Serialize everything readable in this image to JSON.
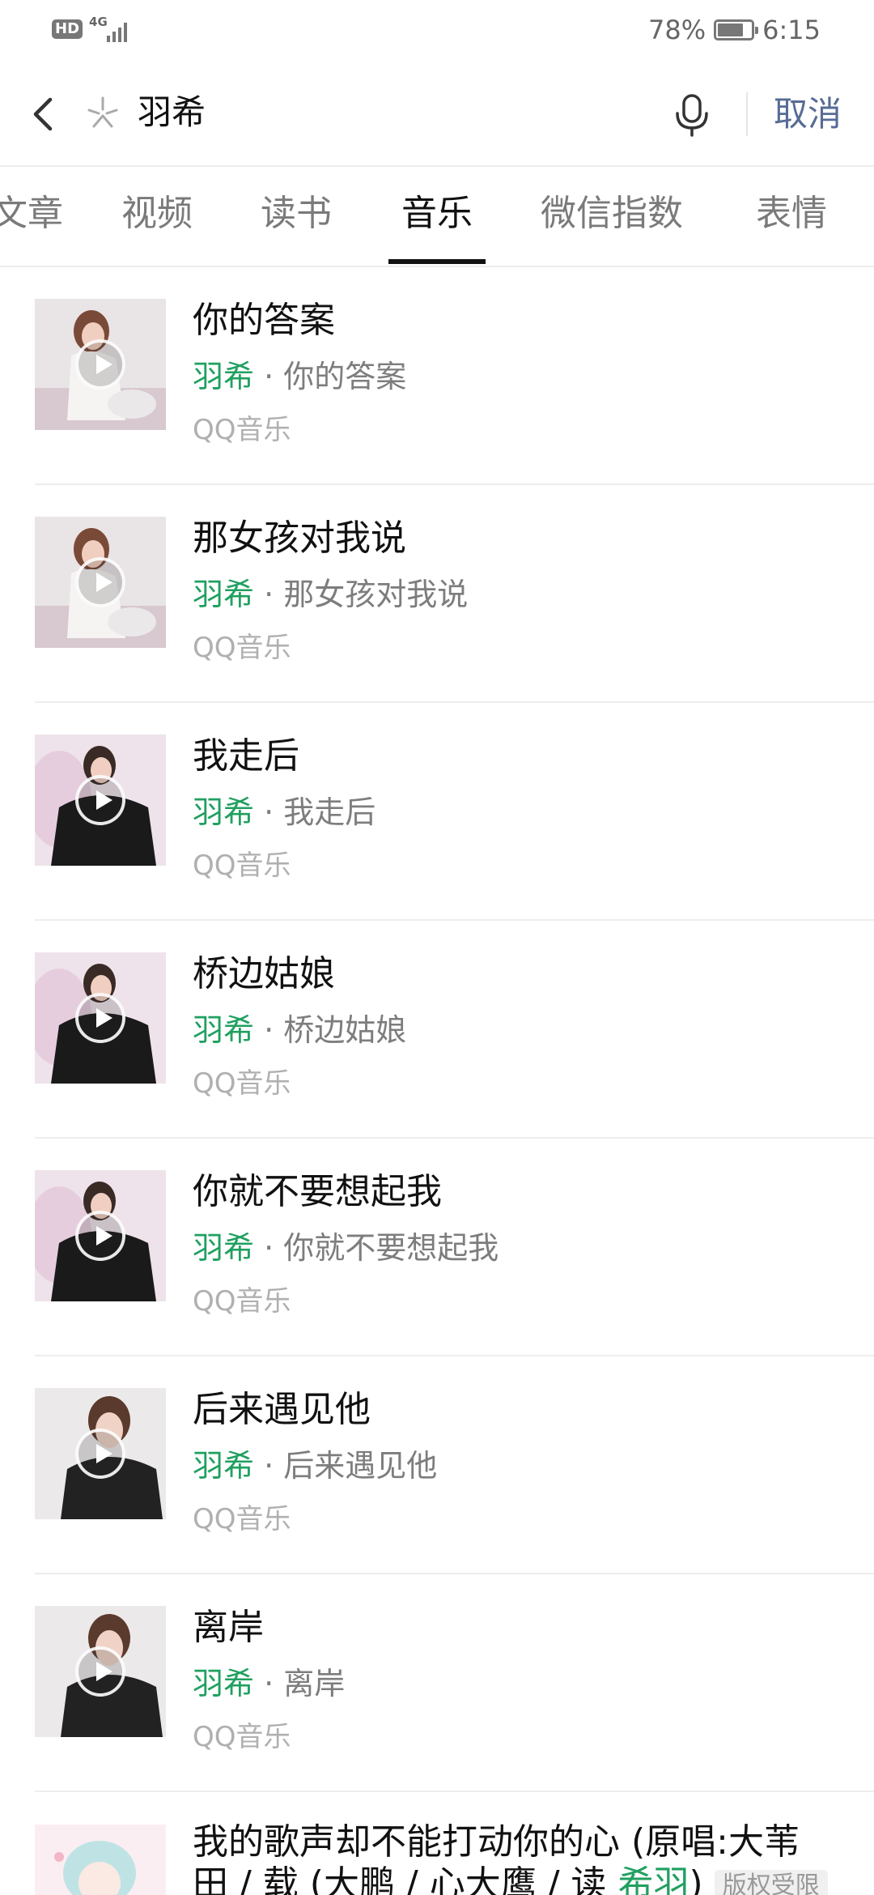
{
  "status_bar": {
    "hd": "HD",
    "network": "4G",
    "battery": "78%",
    "time": "6:15"
  },
  "search": {
    "query": "羽希",
    "cancel_label": "取消"
  },
  "tabs": [
    {
      "label": "文章"
    },
    {
      "label": "视频"
    },
    {
      "label": "读书"
    },
    {
      "label": "音乐"
    },
    {
      "label": "微信指数"
    },
    {
      "label": "表情"
    }
  ],
  "results": [
    {
      "title": "你的答案",
      "artist": "羽希",
      "album": " · 你的答案",
      "source": "QQ音乐"
    },
    {
      "title": "那女孩对我说",
      "artist": "羽希",
      "album": " · 那女孩对我说",
      "source": "QQ音乐"
    },
    {
      "title": "我走后",
      "artist": "羽希",
      "album": " · 我走后",
      "source": "QQ音乐"
    },
    {
      "title": "桥边姑娘",
      "artist": "羽希",
      "album": " · 桥边姑娘",
      "source": "QQ音乐"
    },
    {
      "title": "你就不要想起我",
      "artist": "羽希",
      "album": " · 你就不要想起我",
      "source": "QQ音乐"
    },
    {
      "title": "后来遇见他",
      "artist": "羽希",
      "album": " · 后来遇见他",
      "source": "QQ音乐"
    },
    {
      "title": "离岸",
      "artist": "羽希",
      "album": " · 离岸",
      "source": "QQ音乐"
    }
  ],
  "last_result": {
    "title_part1": "我的歌声却不能打动你的心 (原唱:大苇",
    "title_part2": "田 / 载 (大鹏 / 心大鹰 / 读 ",
    "highlight": "希羽",
    "title_part3": ")",
    "tag": "版权受限"
  }
}
